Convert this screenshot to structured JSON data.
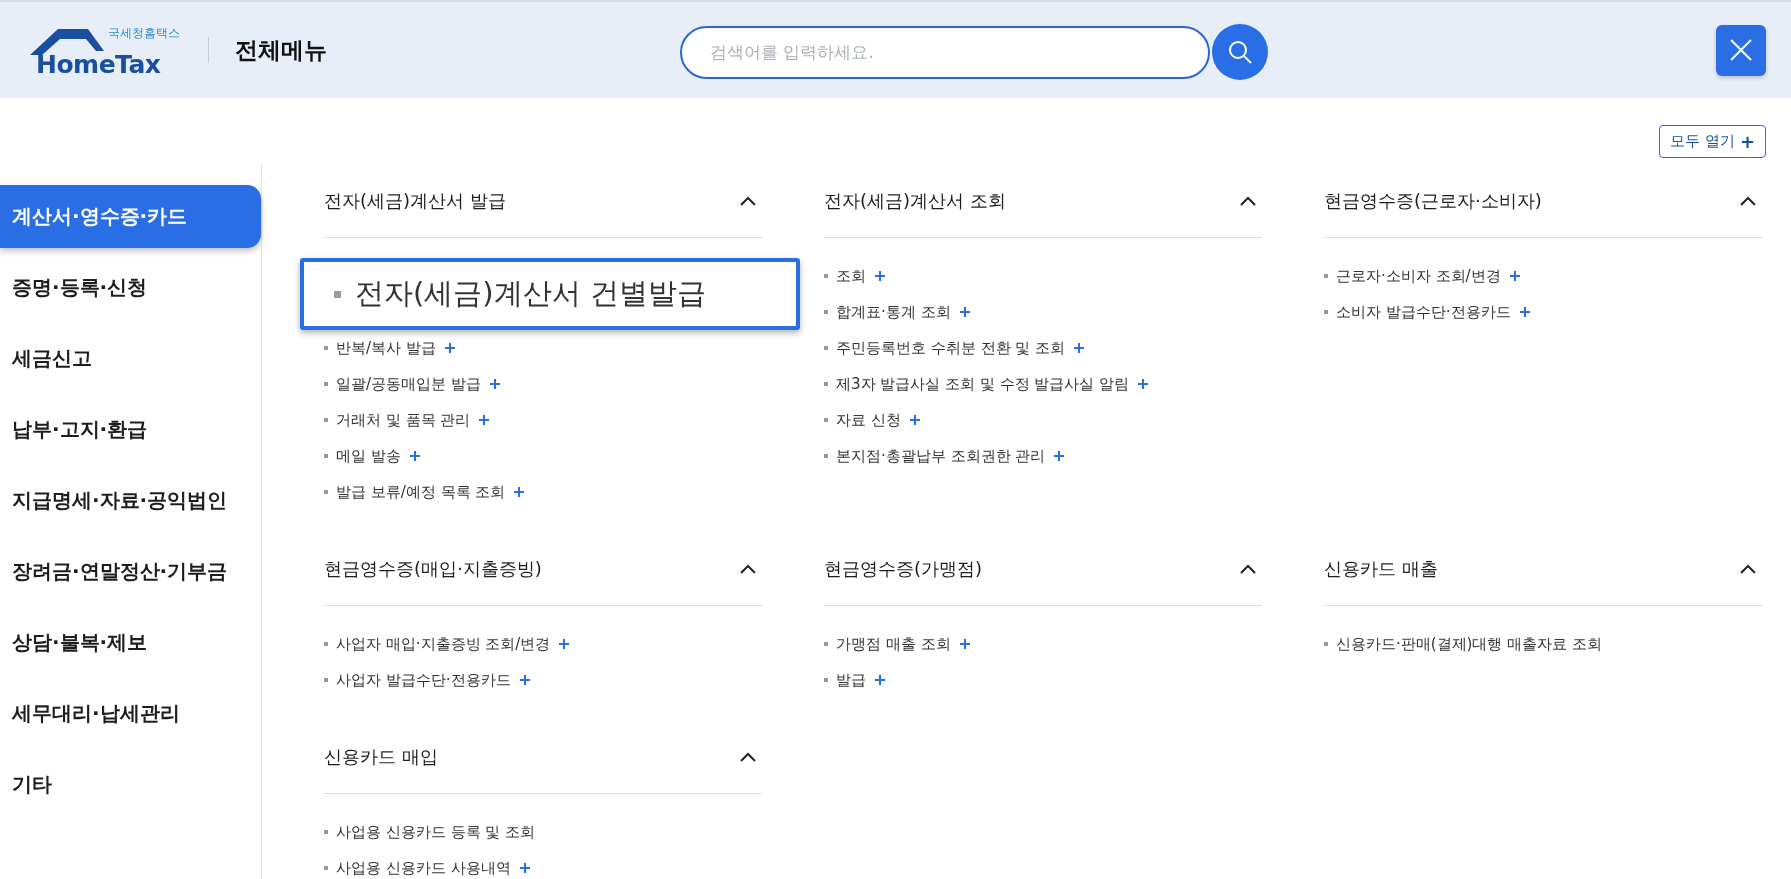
{
  "header": {
    "logo": {
      "small": "국세청홈택스",
      "name": "HomeTax"
    },
    "title": "전체메뉴",
    "search": {
      "placeholder": "검색어를 입력하세요."
    }
  },
  "open_all": {
    "label": "모두 열기",
    "icon": "+"
  },
  "sidebar": {
    "items": [
      {
        "label": "계산서·영수증·카드",
        "selected": true
      },
      {
        "label": "증명·등록·신청",
        "selected": false
      },
      {
        "label": "세금신고",
        "selected": false
      },
      {
        "label": "납부·고지·환급",
        "selected": false
      },
      {
        "label": "지급명세·자료·공익법인",
        "selected": false
      },
      {
        "label": "장려금·연말정산·기부금",
        "selected": false
      },
      {
        "label": "상담·불복·제보",
        "selected": false
      },
      {
        "label": "세무대리·납세관리",
        "selected": false
      },
      {
        "label": "기타",
        "selected": false
      }
    ]
  },
  "sections": [
    [
      {
        "title": "전자(세금)계산서 발급",
        "expanded": true,
        "items": [
          {
            "label": "전자(세금)계산서 건별발급",
            "expandable": false,
            "highlighted": true
          },
          {
            "label": "반복/복사 발급",
            "expandable": true,
            "highlighted": false
          },
          {
            "label": "일괄/공동매입분 발급",
            "expandable": true,
            "highlighted": false
          },
          {
            "label": "거래처 및 품목 관리",
            "expandable": true,
            "highlighted": false
          },
          {
            "label": "메일 발송",
            "expandable": true,
            "highlighted": false
          },
          {
            "label": "발급 보류/예정 목록 조회",
            "expandable": true,
            "highlighted": false
          }
        ]
      },
      {
        "title": "전자(세금)계산서 조회",
        "expanded": true,
        "items": [
          {
            "label": "조회",
            "expandable": true,
            "highlighted": false
          },
          {
            "label": "합계표·통계 조회",
            "expandable": true,
            "highlighted": false
          },
          {
            "label": "주민등록번호 수취분 전환 및 조회",
            "expandable": true,
            "highlighted": false
          },
          {
            "label": "제3자 발급사실 조회 및 수정 발급사실 알림",
            "expandable": true,
            "highlighted": false
          },
          {
            "label": "자료 신청",
            "expandable": true,
            "highlighted": false
          },
          {
            "label": "본지점·총괄납부 조회권한 관리",
            "expandable": true,
            "highlighted": false
          }
        ]
      },
      {
        "title": "현금영수증(근로자·소비자)",
        "expanded": true,
        "items": [
          {
            "label": "근로자·소비자 조회/변경",
            "expandable": true,
            "highlighted": false
          },
          {
            "label": "소비자 발급수단·전용카드",
            "expandable": true,
            "highlighted": false
          }
        ]
      }
    ],
    [
      {
        "title": "현금영수증(매입·지출증빙)",
        "expanded": true,
        "items": [
          {
            "label": "사업자 매입·지출증빙 조회/변경",
            "expandable": true,
            "highlighted": false
          },
          {
            "label": "사업자 발급수단·전용카드",
            "expandable": true,
            "highlighted": false
          }
        ]
      },
      {
        "title": "현금영수증(가맹점)",
        "expanded": true,
        "items": [
          {
            "label": "가맹점 매출 조회",
            "expandable": true,
            "highlighted": false
          },
          {
            "label": "발급",
            "expandable": true,
            "highlighted": false
          }
        ]
      },
      {
        "title": "신용카드 매출",
        "expanded": true,
        "items": [
          {
            "label": "신용카드·판매(결제)대행 매출자료 조회",
            "expandable": false,
            "highlighted": false
          }
        ]
      }
    ],
    [
      {
        "title": "신용카드 매입",
        "expanded": true,
        "items": [
          {
            "label": "사업용 신용카드 등록 및 조회",
            "expandable": false,
            "highlighted": false
          },
          {
            "label": "사업용 신용카드 사용내역",
            "expandable": true,
            "highlighted": false
          }
        ]
      }
    ]
  ]
}
